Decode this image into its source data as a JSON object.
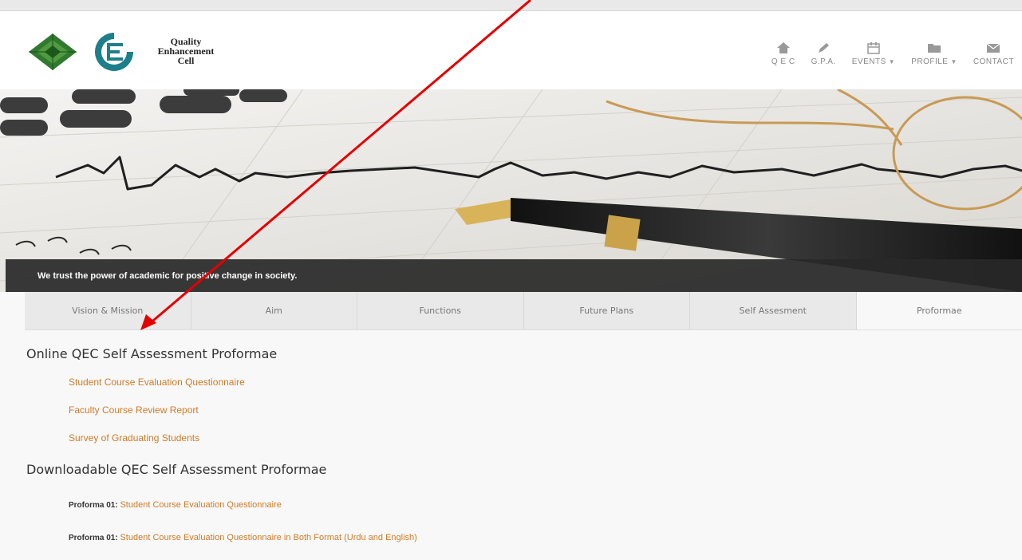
{
  "header": {
    "logo_text": [
      "Quality",
      "Enhancement",
      "Cell"
    ],
    "nav": [
      {
        "label": "Q E C",
        "icon": "home-icon",
        "caret": false
      },
      {
        "label": "G.P.A.",
        "icon": "pen-icon",
        "caret": false
      },
      {
        "label": "EVENTS",
        "icon": "calendar-icon",
        "caret": true
      },
      {
        "label": "PROFILE",
        "icon": "folder-icon",
        "caret": true
      },
      {
        "label": "CONTACT",
        "icon": "mail-icon",
        "caret": false
      }
    ]
  },
  "hero": {
    "caption": "We trust the power of academic for positive change in society."
  },
  "tabs": [
    {
      "label": "Vision & Mission",
      "active": false
    },
    {
      "label": "Aim",
      "active": false
    },
    {
      "label": "Functions",
      "active": false
    },
    {
      "label": "Future Plans",
      "active": false
    },
    {
      "label": "Self Assesment",
      "active": false
    },
    {
      "label": "Proformae",
      "active": true
    }
  ],
  "online": {
    "heading": "Online QEC Self Assessment Proformae",
    "links": [
      "Student Course Evaluation Questionnaire",
      "Faculty Course Review Report",
      "Survey of Graduating Students"
    ]
  },
  "downloadable": {
    "heading": "Downloadable QEC Self Assessment Proformae",
    "items": [
      {
        "prefix": "Proforma 01: ",
        "link": "Student Course Evaluation Questionnaire"
      },
      {
        "prefix": "Proforma 01: ",
        "link": "Student Course Evaluation Questionnaire in Both Format (Urdu and English)"
      }
    ]
  },
  "colors": {
    "link": "#d07a27",
    "annotation_arrow": "#e30000",
    "caption_bar": "#282828"
  }
}
